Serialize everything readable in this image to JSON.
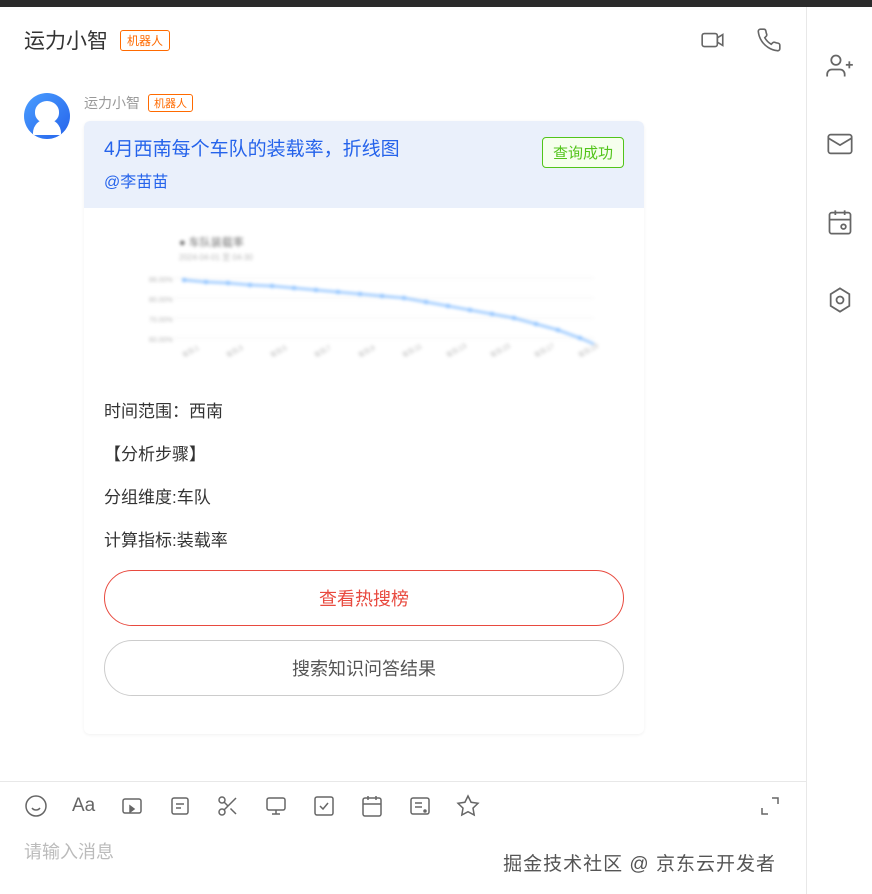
{
  "header": {
    "title": "运力小智",
    "botTag": "机器人"
  },
  "message": {
    "sender": "运力小智",
    "botTag": "机器人",
    "bubbleTitle": "4月西南每个车队的装载率，折线图",
    "mention": "@李苗苗",
    "statusBadge": "查询成功",
    "bodyLines": {
      "line1": "时间范围：西南",
      "line2": "【分析步骤】",
      "line3": "分组维度:车队",
      "line4": "计算指标:装载率"
    },
    "primaryBtn": "查看热搜榜",
    "secondaryBtn": "搜索知识问答结果"
  },
  "input": {
    "placeholder": "请输入消息"
  },
  "watermark": "掘金技术社区 @ 京东云开发者",
  "chart_data": {
    "type": "line",
    "title": "车队装载率",
    "xlabel": "",
    "ylabel": "",
    "note": "图表内容模糊不可读，数值为估计",
    "x": [
      1,
      2,
      3,
      4,
      5,
      6,
      7,
      8,
      9,
      10,
      11,
      12,
      13,
      14,
      15,
      16,
      17,
      18,
      19,
      20
    ],
    "values": [
      88,
      87,
      86,
      85,
      84,
      83,
      82,
      81,
      80,
      79,
      78,
      76,
      74,
      72,
      70,
      68,
      65,
      62,
      58,
      55
    ],
    "ylim": [
      50,
      90
    ]
  }
}
